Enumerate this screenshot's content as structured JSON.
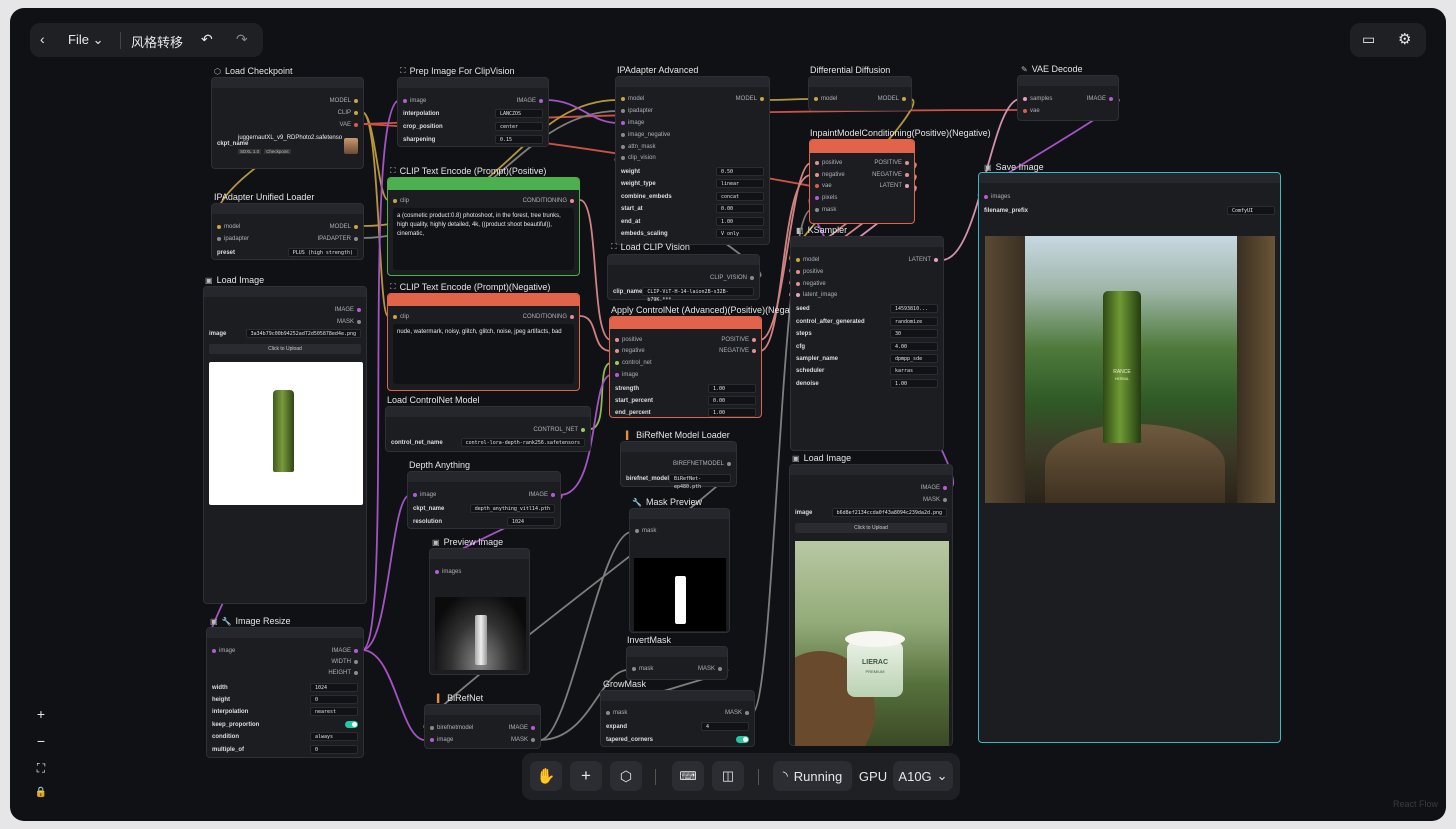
{
  "header": {
    "file_label": "File",
    "title": "风格转移"
  },
  "toolbar": {
    "status": "Running",
    "gpu_label": "GPU",
    "gpu_value": "A10G"
  },
  "watermark": "React Flow",
  "nodes": {
    "load_checkpoint": {
      "title": "Load Checkpoint",
      "outputs": [
        "MODEL",
        "CLIP",
        "VAE"
      ],
      "ckpt_label": "ckpt_name",
      "ckpt_value": "juggernautXL_v9_RDPhoto2.safetenso",
      "tags": [
        "SDXL 1.0",
        "Checkpoint"
      ]
    },
    "ipadapter_loader": {
      "title": "IPAdapter Unified Loader",
      "inputs": [
        "model",
        "ipadapter"
      ],
      "outputs": [
        "MODEL",
        "IPADAPTER"
      ],
      "preset_label": "preset",
      "preset_value": "PLUS (high strength)"
    },
    "load_image_1": {
      "title": "Load Image",
      "outputs": [
        "IMAGE",
        "MASK"
      ],
      "image_label": "image",
      "image_value": "3a34b79c00b94252ad72d505878ed4e.png",
      "upload": "Click to Upload"
    },
    "prep_image": {
      "title": "Prep Image For ClipVision",
      "input": "image",
      "output": "IMAGE",
      "widgets": [
        [
          "interpolation",
          "LANCZOS"
        ],
        [
          "crop_position",
          "center"
        ],
        [
          "sharpening",
          "0.15"
        ]
      ]
    },
    "clip_pos": {
      "title": "CLIP Text Encode (Prompt)(Positive)",
      "input": "clip",
      "output": "CONDITIONING",
      "text": "a (cosmetic product:0.8) photoshoot, in the forest, tree trunks, high quality, highly detailed, 4k, ((product shoot beautiful)), cinematic,"
    },
    "clip_neg": {
      "title": "CLIP Text Encode (Prompt)(Negative)",
      "input": "clip",
      "output": "CONDITIONING",
      "text": "nude, watermark, noisy, glitch, glitch, noise, jpeg artifacts, bad"
    },
    "load_controlnet": {
      "title": "Load ControlNet Model",
      "output": "CONTROL_NET",
      "label": "control_net_name",
      "value": "control-lora-depth-rank256.safetensors"
    },
    "depth_anything": {
      "title": "Depth Anything",
      "input": "image",
      "output": "IMAGE",
      "widgets": [
        [
          "ckpt_name",
          "depth_anything_vitl14.pth"
        ],
        [
          "resolution",
          "1024"
        ]
      ]
    },
    "preview_image": {
      "title": "Preview Image",
      "input": "images"
    },
    "image_resize": {
      "title": "Image Resize",
      "input": "image",
      "outputs": [
        "IMAGE",
        "WIDTH",
        "HEIGHT"
      ],
      "widgets": [
        [
          "width",
          "1024"
        ],
        [
          "height",
          "0"
        ],
        [
          "interpolation",
          "nearest"
        ],
        [
          "keep_proportion",
          ""
        ],
        [
          "condition",
          "always"
        ],
        [
          "multiple_of",
          "0"
        ]
      ]
    },
    "birefnet": {
      "title": "BiRefNet",
      "inputs": [
        "birefnetmodel",
        "image"
      ],
      "outputs": [
        "IMAGE",
        "MASK"
      ]
    },
    "ipadapter_adv": {
      "title": "IPAdapter Advanced",
      "inputs": [
        "model",
        "ipadapter",
        "image",
        "image_negative",
        "attn_mask",
        "clip_vision"
      ],
      "output": "MODEL",
      "widgets": [
        [
          "weight",
          "0.50"
        ],
        [
          "weight_type",
          "linear"
        ],
        [
          "combine_embeds",
          "concat"
        ],
        [
          "start_at",
          "0.00"
        ],
        [
          "end_at",
          "1.00"
        ],
        [
          "embeds_scaling",
          "V only"
        ]
      ]
    },
    "load_clip_vision": {
      "title": "Load CLIP Vision",
      "output": "CLIP_VISION",
      "label": "clip_name",
      "value": "CLIP-ViT-H-14-laion2B-s32B-b79K.***"
    },
    "apply_controlnet": {
      "title": "Apply ControlNet (Advanced)(Positive)(Negative)",
      "inputs": [
        "positive",
        "negative",
        "control_net",
        "image"
      ],
      "outputs": [
        "POSITIVE",
        "NEGATIVE"
      ],
      "widgets": [
        [
          "strength",
          "1.00"
        ],
        [
          "start_percent",
          "0.00"
        ],
        [
          "end_percent",
          "1.00"
        ]
      ]
    },
    "birefnet_loader": {
      "title": "BiRefNet Model Loader",
      "output": "BIREFNETMODEL",
      "label": "birefnet_model",
      "value": "BiRefNet-ep480.pth"
    },
    "mask_preview": {
      "title": "Mask Preview",
      "input": "mask"
    },
    "invert_mask": {
      "title": "InvertMask",
      "input": "mask",
      "output": "MASK"
    },
    "grow_mask": {
      "title": "GrowMask",
      "input": "mask",
      "output": "MASK",
      "widgets": [
        [
          "expand",
          "4"
        ],
        [
          "tapered_corners",
          ""
        ]
      ]
    },
    "diff_diffusion": {
      "title": "Differential Diffusion",
      "input": "model",
      "output": "MODEL"
    },
    "inpaint_cond": {
      "title": "InpaintModelConditioning(Positive)(Negative)",
      "inputs": [
        "positive",
        "negative",
        "vae",
        "pixels",
        "mask"
      ],
      "outputs": [
        "POSITIVE",
        "NEGATIVE",
        "LATENT"
      ]
    },
    "ksampler": {
      "title": "KSampler",
      "inputs": [
        "model",
        "positive",
        "negative",
        "latent_image"
      ],
      "output": "LATENT",
      "widgets": [
        [
          "seed",
          "14593810..."
        ],
        [
          "control_after_generated",
          "randomize"
        ],
        [
          "steps",
          "30"
        ],
        [
          "cfg",
          "4.00"
        ],
        [
          "sampler_name",
          "dpmpp_sde"
        ],
        [
          "scheduler",
          "karras"
        ],
        [
          "denoise",
          "1.00"
        ]
      ]
    },
    "load_image_2": {
      "title": "Load Image",
      "outputs": [
        "IMAGE",
        "MASK"
      ],
      "image_label": "image",
      "image_value": "b6d8ef2134ccda0f43a8094c239da2d.png",
      "upload": "Click to Upload"
    },
    "vae_decode": {
      "title": "VAE Decode",
      "inputs": [
        "samples",
        "vae"
      ],
      "output": "IMAGE"
    },
    "save_image": {
      "title": "Save Image",
      "input": "images",
      "prefix_label": "filename_prefix",
      "prefix_value": "ComfyUI"
    }
  },
  "products": {
    "bottle_brand": "RANCE",
    "bottle_sub": "HERBAL",
    "jar_brand": "LIERAC",
    "jar_sub": "PREMIUM"
  },
  "colors": {
    "model": "#c9a640",
    "clip": "#c9a640",
    "vae": "#e05a4a",
    "image": "#b45bd6",
    "mask": "#8a8a8a",
    "conditioning": "#e58f8f",
    "latent": "#e8a0c0",
    "accent_teal": "#26c6a8"
  }
}
